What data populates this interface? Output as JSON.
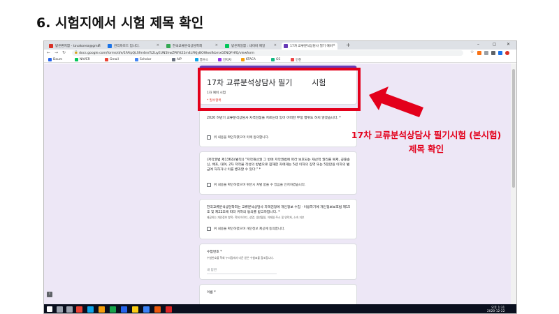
{
  "slide": {
    "title": "6. 시험지에서 시험 제목 확인"
  },
  "browser": {
    "tabs": [
      {
        "label": "받은편지함 - tavakorea@gmai",
        "color": "#d93025",
        "active": false
      },
      {
        "label": "관리자모드 입니다.",
        "color": "#1a73e8",
        "active": false
      },
      {
        "label": "한국교류분석상담학회",
        "color": "#34a853",
        "active": false
      },
      {
        "label": "받은파일함 : 네이버 메일",
        "color": "#03c75a",
        "active": false
      },
      {
        "label": "17차 교류분석상담사 필기 예비",
        "color": "#673ab7",
        "active": true
      }
    ],
    "new_tab": "+",
    "url": "docs.google.com/forms/d/e/1FAIpQLSfm4nnTcZuyEUN5hwZP8Yt22m4LFKJyBOWwsfkbmx0ZNQFHfQ/viewform",
    "window_controls": {
      "minimize": "–",
      "maximize": "◻",
      "close": "✕"
    },
    "nav": {
      "back": "←",
      "forward": "→",
      "reload": "↻"
    },
    "extensions": [
      {
        "name": "star-icon",
        "glyph": "☆",
        "color": "#ffffff"
      },
      {
        "name": "ext-orange",
        "glyph": "",
        "color": "#f97316"
      },
      {
        "name": "ext-gray",
        "glyph": "",
        "color": "#9aa0a6"
      },
      {
        "name": "ext-puzzle",
        "glyph": "",
        "color": "#5f6368"
      },
      {
        "name": "ext-blue",
        "glyph": "",
        "color": "#1a73e8"
      },
      {
        "name": "profile-avatar",
        "glyph": "",
        "color": "#d93025"
      }
    ],
    "bookmarks": [
      {
        "label": "Daum",
        "color": "#2563eb"
      },
      {
        "label": "NAVER",
        "color": "#03c75a"
      },
      {
        "label": "Gmail",
        "color": "#ea4335"
      },
      {
        "label": "Scholar",
        "color": "#4285f4"
      },
      {
        "label": "AIP",
        "color": "#6b7280"
      },
      {
        "label": "통우스",
        "color": "#0ea5e9"
      },
      {
        "label": "전자자",
        "color": "#9333ea"
      },
      {
        "label": "KTACA",
        "color": "#f59e0b"
      },
      {
        "label": "GS",
        "color": "#10b981"
      },
      {
        "label": "인천",
        "color": "#ef4444"
      }
    ]
  },
  "form": {
    "title": "17차 교류분석상담사 필기        시험",
    "subtitle": "1차 예비 시험",
    "required_note": "* 필수항목",
    "questions": [
      {
        "text": "2020 하반기 교류분석상담사 자격검정을 치르는데 있어 어떠한 부정 행위도 하지 않겠습니다. *",
        "checkbox": "위 내용을 확인하였으며 이에 동의합니다."
      },
      {
        "text": "(저작권법 제136조(벌칙)) \"저작재산권 그 밖에 저작권법에 따라 보호되는 재산적 권리를 복제, 공중송신, 배포, 대여, 2차 저작물 작성의 방법으로 침해한 자에게는 5년 이하의 징역 또는 5천만원 이하의 벌금에 처하거나 이를 병과할 수 있다.\" *",
        "checkbox": "위 내용을 확인하였으며 위반시 처벌 받을 수 있음을 인지하였습니다."
      },
      {
        "text": "한국교류분석상담학회는 교류분석상담사 자격검정에 개인정보 수집 · 이용하기에 개인정보보호법 제15조 및 제22조에 따라 귀하의 동의를 받고자합니다. *",
        "small": "제공하는 개인정보 항목: 학회 아이디, 성명, 생년월일, 이메일 주소 및 연락처, 소속 지부",
        "checkbox": "위 내용을 확인하였으며 개인정보 제공에 동의합니다."
      }
    ],
    "exam_number": {
      "label": "수험번호 *",
      "hint": "수험번호를 학회 누리집에서 다운 받은 수험표를 참조합니다.",
      "placeholder": "내 답변"
    },
    "name_label": "이름 *",
    "help_glyph": "!"
  },
  "taskbar": {
    "icons": [
      {
        "name": "windows-start-icon",
        "color": "#ffffff"
      },
      {
        "name": "search-icon",
        "color": "#9ca3af"
      },
      {
        "name": "task-view-icon",
        "color": "#9ca3af"
      },
      {
        "name": "chrome-icon",
        "color": "#ea4335"
      },
      {
        "name": "edge-icon",
        "color": "#0ea5e9"
      },
      {
        "name": "explorer-icon",
        "color": "#f59e0b"
      },
      {
        "name": "excel-icon",
        "color": "#16a34a"
      },
      {
        "name": "word-icon",
        "color": "#2563eb"
      },
      {
        "name": "kakaotalk-icon",
        "color": "#facc15"
      },
      {
        "name": "hangul-icon",
        "color": "#3b82f6"
      },
      {
        "name": "powerpoint-icon",
        "color": "#ea580c"
      },
      {
        "name": "app-icon",
        "color": "#dc2626"
      }
    ],
    "time": "오후 1:31",
    "date": "2020-12-22"
  },
  "annotation": {
    "line1": "17차 교류분석상담사 필기시험 (본시험)",
    "line2": "제목 확인",
    "color": "#e3001b"
  }
}
